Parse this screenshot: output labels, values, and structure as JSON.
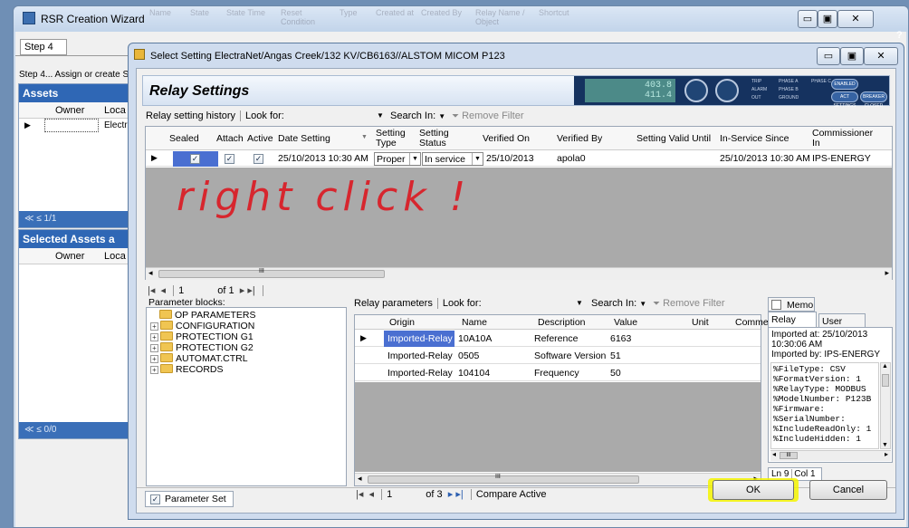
{
  "wizard": {
    "title": "RSR Creation Wizard",
    "step_tab": "Step 4",
    "step_desc": "Step 4... Assign or create S",
    "assets_header": "Assets",
    "assets_cols": [
      "Owner",
      "Loca"
    ],
    "assets_row_loc": "Electri",
    "assets_pager": "≪  ≤  1/1",
    "selected_header": "Selected Assets a",
    "selected_cols": [
      "Owner",
      "Loca"
    ],
    "selected_pager": "≪  ≤  0/0",
    "ghost_headers": [
      "Name",
      "State",
      "State Time",
      "Reset Condition",
      "Type",
      "Created at",
      "Created By",
      "Relay Name / Object",
      "Shortcut"
    ]
  },
  "dialog": {
    "title": "Select Setting ElectraNet/Angas Creek/132 KV/CB6163//ALSTOM MICOM P123",
    "header_title": "Relay Settings",
    "relay_lcd": [
      "403.8",
      "411.4"
    ],
    "relay_tiny": [
      "TRIP",
      "ALARM",
      "OUT",
      "PHASE A",
      "PHASE B",
      "GROUND",
      "PHASE C",
      "ENABLED",
      "ACT SETTINGS",
      "BREAKER CLOSED"
    ],
    "history_toolbar": {
      "label": "Relay setting history",
      "look_for": "Look for:",
      "search_in": "Search In:",
      "remove_filter": "Remove Filter"
    },
    "settings_columns": [
      "Sealed",
      "Attach",
      "Active",
      "Date Setting",
      "Setting Type",
      "Setting Status",
      "Verified On",
      "Verified By",
      "Setting Valid Until",
      "In-Service Since",
      "Commissioner In"
    ],
    "settings_row": {
      "date_setting": "25/10/2013 10:30 AM",
      "setting_type": "Proper",
      "setting_status": "In service",
      "verified_on": "25/10/2013",
      "verified_by": "apola0",
      "valid_until": "",
      "in_service_since": "25/10/2013 10:30 AM",
      "commissioner": "IPS-ENERGY"
    },
    "annotation": "right click !",
    "settings_nav": {
      "current": "1",
      "of": "of 1"
    },
    "param_blocks_label": "Parameter blocks:",
    "param_blocks": [
      {
        "label": "OP PARAMETERS",
        "expandable": false
      },
      {
        "label": "CONFIGURATION",
        "expandable": true
      },
      {
        "label": "PROTECTION G1",
        "expandable": true
      },
      {
        "label": "PROTECTION G2",
        "expandable": true
      },
      {
        "label": "AUTOMAT.CTRL",
        "expandable": true
      },
      {
        "label": "RECORDS",
        "expandable": true
      }
    ],
    "params_toolbar": {
      "label": "Relay parameters",
      "look_for": "Look for:",
      "search_in": "Search In:",
      "remove_filter": "Remove Filter"
    },
    "params_columns": [
      "Origin",
      "Name",
      "Description",
      "Value",
      "Unit",
      "Comme"
    ],
    "params_rows": [
      {
        "origin": "Imported-Relay",
        "name": "10A10A",
        "description": "Reference",
        "value": "6163",
        "unit": ""
      },
      {
        "origin": "Imported-Relay",
        "name": "0505",
        "description": "Software Version",
        "value": "51",
        "unit": ""
      },
      {
        "origin": "Imported-Relay",
        "name": "104104",
        "description": "Frequency",
        "value": "50",
        "unit": ""
      }
    ],
    "params_nav": {
      "current": "1",
      "of": "of 3",
      "compare": "Compare Active"
    },
    "memo_label": "Memo",
    "tabs": [
      "Relay Data",
      "User Data"
    ],
    "import_info": [
      "Imported at: 25/10/2013",
      "10:30:06 AM",
      "Imported by: IPS-ENERGY"
    ],
    "file_lines": [
      "%FileType: CSV",
      "%FormatVersion: 1",
      "%RelayType: MODBUS",
      "%ModelNumber: P123B",
      "%Firmware:",
      "%SerialNumber:",
      "%IncludeReadOnly: 1",
      "%IncludeHidden: 1"
    ],
    "scroll_mid": "III",
    "status": {
      "ln": "Ln 9",
      "col": "Col 1"
    },
    "parameter_set_label": "Parameter Set",
    "ok_label": "OK",
    "cancel_label": "Cancel"
  },
  "colors": {
    "highlight": "#f4f400",
    "selection": "#4a6fd1",
    "annotation": "#d7262e",
    "panel": "#2f67b5"
  }
}
